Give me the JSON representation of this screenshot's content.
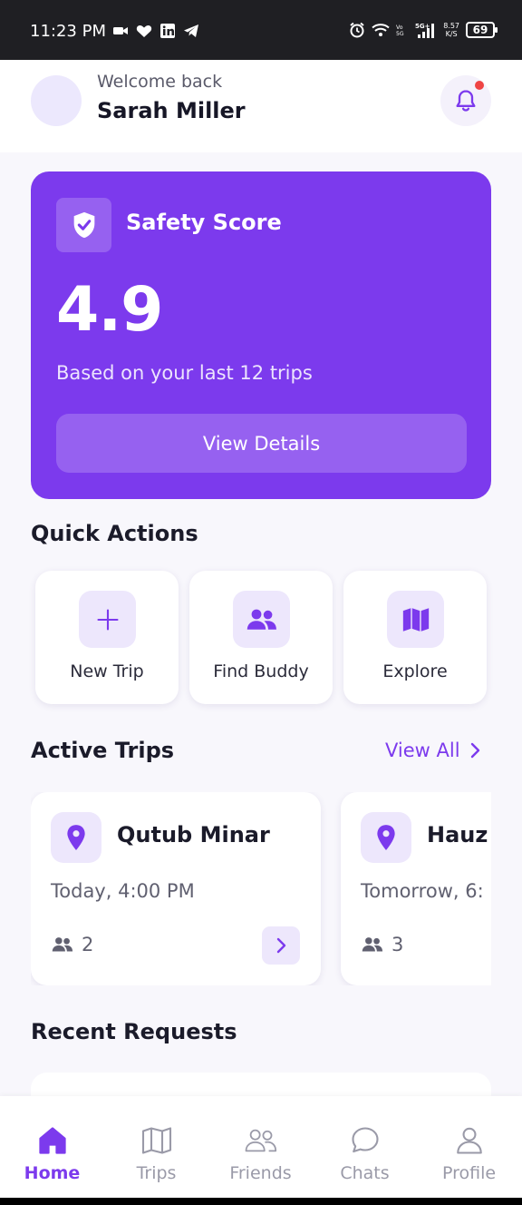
{
  "status_bar": {
    "time": "11:23 PM",
    "left_icons": [
      "video-icon",
      "heart-icon",
      "linkedin-icon",
      "telegram-icon"
    ],
    "right_icons": [
      "alarm-icon",
      "wifi-icon",
      "volte-icon",
      "signal-icon"
    ],
    "net_speed_value": "8.57",
    "net_speed_unit": "K/S",
    "battery": "69"
  },
  "header": {
    "welcome": "Welcome back",
    "user_name": "Sarah Miller"
  },
  "safety": {
    "title": "Safety Score",
    "score": "4.9",
    "subtitle": "Based on your last 12 trips",
    "button": "View Details"
  },
  "quick_actions": {
    "title": "Quick Actions",
    "items": [
      {
        "label": "New Trip",
        "icon": "plus-icon"
      },
      {
        "label": "Find Buddy",
        "icon": "users-icon"
      },
      {
        "label": "Explore",
        "icon": "map-icon"
      }
    ]
  },
  "active_trips": {
    "title": "Active Trips",
    "view_all": "View All",
    "trips": [
      {
        "name": "Qutub Minar",
        "time": "Today, 4:00 PM",
        "people": "2"
      },
      {
        "name": "Hauz",
        "time": "Tomorrow, 6:",
        "people": "3"
      }
    ]
  },
  "recent_requests": {
    "title": "Recent Requests"
  },
  "nav": {
    "items": [
      {
        "label": "Home",
        "icon": "home-icon"
      },
      {
        "label": "Trips",
        "icon": "map-icon"
      },
      {
        "label": "Friends",
        "icon": "users-icon"
      },
      {
        "label": "Chats",
        "icon": "chat-icon"
      },
      {
        "label": "Profile",
        "icon": "user-icon"
      }
    ]
  },
  "colors": {
    "primary": "#7c3aed",
    "primary_light": "#ede7fc",
    "background": "#f8f7fc",
    "notification_dot": "#ef4444"
  }
}
